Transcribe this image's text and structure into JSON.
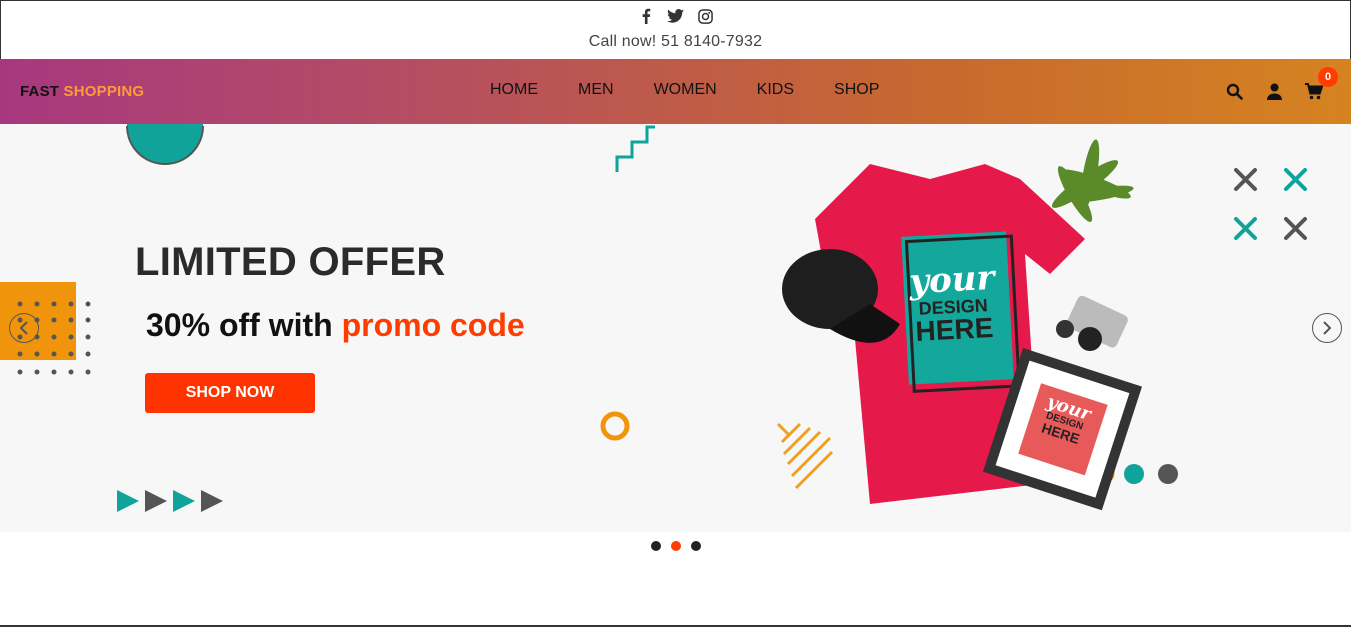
{
  "topbar": {
    "socials": [
      {
        "icon": "facebook-icon"
      },
      {
        "icon": "twitter-icon"
      },
      {
        "icon": "instagram-icon"
      }
    ],
    "call": "Call now! 51 8140-7932"
  },
  "nav": {
    "logo_part1": "FAST",
    "logo_part2": "SHOPPING",
    "items": [
      {
        "label": "HOME"
      },
      {
        "label": "MEN"
      },
      {
        "label": "WOMEN"
      },
      {
        "label": "KIDS"
      },
      {
        "label": "SHOP"
      }
    ],
    "cart_count": "0"
  },
  "hero": {
    "headline": "LIMITED OFFER",
    "sub_prefix": "30% off with",
    "sub_highlight": "promo code",
    "button": "SHOP NOW",
    "tshirt_text_1": "your",
    "tshirt_text_2": "DESIGN",
    "tshirt_text_3": "HERE"
  },
  "slider": {
    "slide_count": 3,
    "active_index": 1
  },
  "colors": {
    "accent": "#ff3d00",
    "teal": "#10a39a",
    "orange": "#f0940c",
    "shirt": "#e6194b"
  }
}
